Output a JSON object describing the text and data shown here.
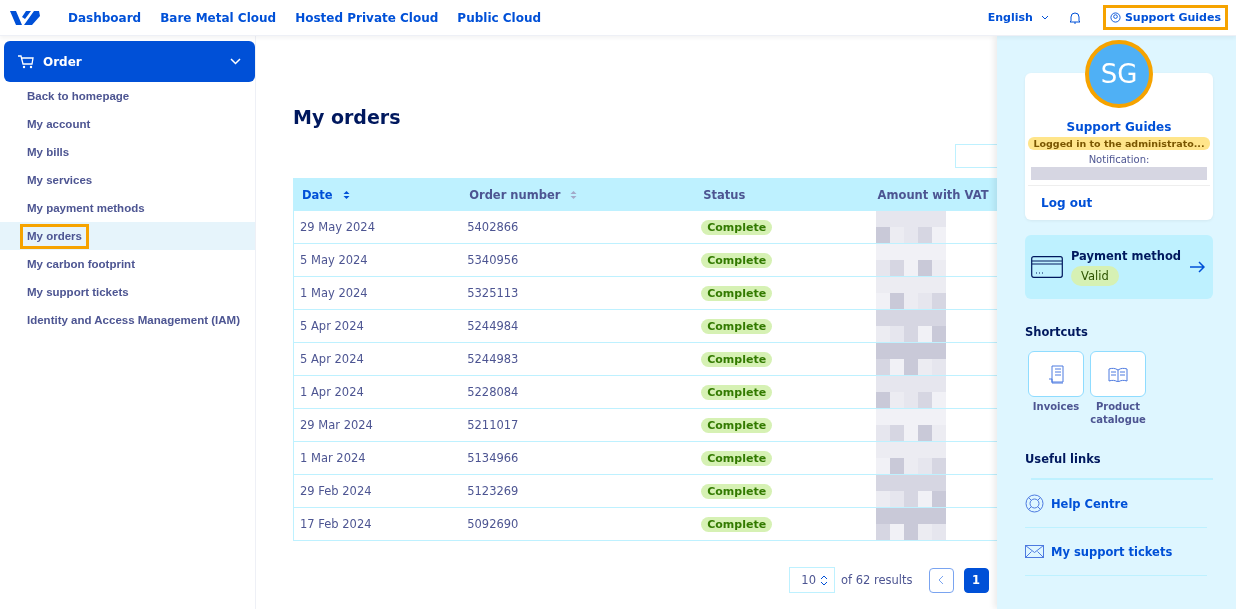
{
  "topbar": {
    "nav": [
      "Dashboard",
      "Bare Metal Cloud",
      "Hosted Private Cloud",
      "Public Cloud"
    ],
    "language": "English",
    "account": {
      "label": "Support Guides",
      "highlighted": true
    }
  },
  "sidebar": {
    "section": {
      "label": "Order",
      "expanded": true
    },
    "items": [
      {
        "label": "Back to homepage",
        "selected": false,
        "highlighted": false
      },
      {
        "label": "My account",
        "selected": false,
        "highlighted": false
      },
      {
        "label": "My bills",
        "selected": false,
        "highlighted": false
      },
      {
        "label": "My services",
        "selected": false,
        "highlighted": false
      },
      {
        "label": "My payment methods",
        "selected": false,
        "highlighted": false
      },
      {
        "label": "My orders",
        "selected": true,
        "highlighted": true
      },
      {
        "label": "My carbon footprint",
        "selected": false,
        "highlighted": false
      },
      {
        "label": "My support tickets",
        "selected": false,
        "highlighted": false
      },
      {
        "label": "Identity and Access Management (IAM)",
        "selected": false,
        "highlighted": false
      }
    ]
  },
  "page": {
    "title": "My orders"
  },
  "table": {
    "columns": [
      {
        "label": "Date",
        "sortable": true,
        "sorted": true
      },
      {
        "label": "Order number",
        "sortable": true,
        "sorted": false
      },
      {
        "label": "Status",
        "sortable": false,
        "sorted": false
      },
      {
        "label": "Amount with VAT",
        "sortable": false,
        "sorted": false
      }
    ],
    "rows": [
      {
        "date": "29 May 2024",
        "number": "5402866",
        "status": "Complete"
      },
      {
        "date": "5 May 2024",
        "number": "5340956",
        "status": "Complete"
      },
      {
        "date": "1 May 2024",
        "number": "5325113",
        "status": "Complete"
      },
      {
        "date": "5 Apr 2024",
        "number": "5244984",
        "status": "Complete"
      },
      {
        "date": "5 Apr 2024",
        "number": "5244983",
        "status": "Complete"
      },
      {
        "date": "1 Apr 2024",
        "number": "5228084",
        "status": "Complete"
      },
      {
        "date": "29 Mar 2024",
        "number": "5211017",
        "status": "Complete"
      },
      {
        "date": "1 Mar 2024",
        "number": "5134966",
        "status": "Complete"
      },
      {
        "date": "29 Feb 2024",
        "number": "5123269",
        "status": "Complete"
      },
      {
        "date": "17 Feb 2024",
        "number": "5092690",
        "status": "Complete"
      }
    ]
  },
  "pagination": {
    "page_size": "10",
    "results": "of 62 results",
    "pages": [
      {
        "label": "1",
        "selected": true
      }
    ]
  },
  "account_panel": {
    "initials": "SG",
    "name": "Support Guides",
    "badge": "Logged in to the administrato...",
    "notification_label": "Notification:",
    "logout": "Log out",
    "payment": {
      "title": "Payment method",
      "status": "Valid"
    },
    "shortcuts_title": "Shortcuts",
    "shortcuts": [
      {
        "label": "Invoices",
        "kind": "invoice"
      },
      {
        "label": "Product catalogue",
        "kind": "catalogue"
      }
    ],
    "links_title": "Useful links",
    "links": [
      {
        "label": "Help Centre",
        "kind": "help"
      },
      {
        "label": "My support tickets",
        "kind": "mail"
      }
    ]
  }
}
